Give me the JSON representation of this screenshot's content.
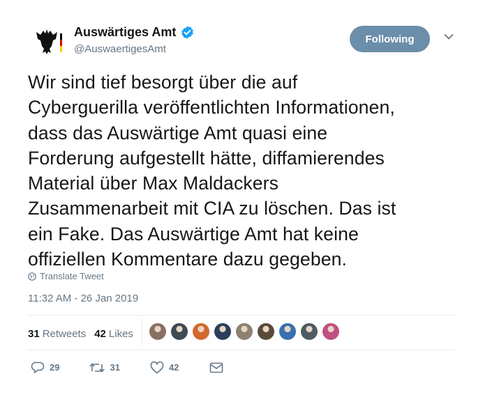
{
  "account": {
    "name": "Auswärtiges Amt",
    "handle": "@AuswaertigesAmt",
    "follow_label": "Following"
  },
  "tweet": {
    "lines": [
      "Wir sind tief besorgt über die auf",
      "Cyberguerilla veröffentlichten Informationen,",
      "dass das Auswärtige Amt quasi eine",
      "Forderung aufgestellt hätte, diffamierendes",
      "Material über Max Maldackers",
      "Zusammenarbeit mit CIA zu löschen. Das ist",
      "ein Fake. Das Auswärtige Amt hat keine",
      "offiziellen Kommentare dazu gegeben."
    ],
    "translate_label": "Translate Tweet",
    "timestamp": "11:32 AM - 26 Jan 2019"
  },
  "stats": {
    "retweets_count": "31",
    "retweets_label": "Retweets",
    "likes_count": "42",
    "likes_label": "Likes"
  },
  "likers": [
    {
      "color": "#8a7060"
    },
    {
      "color": "#3f4a52"
    },
    {
      "color": "#d2692d"
    },
    {
      "color": "#2c3e5c"
    },
    {
      "color": "#8b8270"
    },
    {
      "color": "#5a4a3a"
    },
    {
      "color": "#3a6fb0"
    },
    {
      "color": "#4e5b63"
    },
    {
      "color": "#c05080"
    }
  ],
  "actions": {
    "reply_count": "29",
    "retweet_count": "31",
    "like_count": "42"
  },
  "colors": {
    "follow_button": "#6b8eaa",
    "verified": "#1da1f2",
    "secondary_text": "#657786"
  }
}
